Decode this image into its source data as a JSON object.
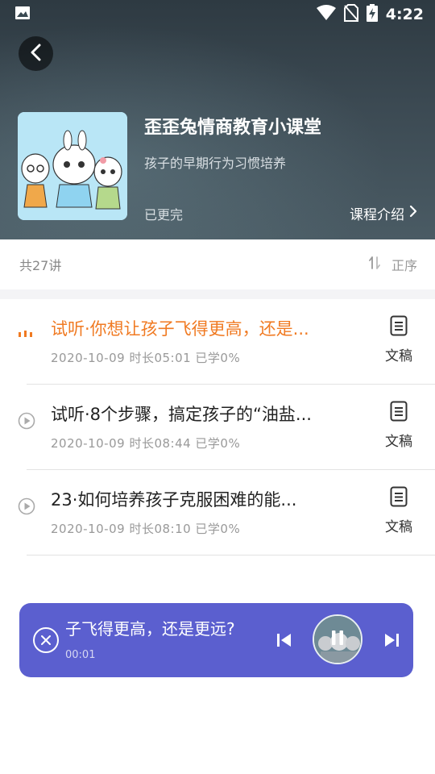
{
  "status_bar": {
    "time": "4:22",
    "icons": [
      "image-icon",
      "wifi-icon",
      "no-sim-icon",
      "battery-charging-icon"
    ]
  },
  "course": {
    "title": "歪歪兔情商教育小课堂",
    "subtitle": "孩子的早期行为习惯培养",
    "update_status": "已更完",
    "intro_link": "课程介绍"
  },
  "list_header": {
    "count": "共27讲",
    "sort_label": "正序"
  },
  "lessons": [
    {
      "title": "试听·你想让孩子飞得更高，还是...",
      "meta": "2020-10-09 时长05:01 已学0%",
      "doc_label": "文稿",
      "state": "playing"
    },
    {
      "title": "试听·8个步骤，搞定孩子的“油盐...",
      "meta": "2020-10-09 时长08:44 已学0%",
      "doc_label": "文稿",
      "state": "idle"
    },
    {
      "title": "23·如何培养孩子克服困难的能...",
      "meta": "2020-10-09 时长08:10 已学0%",
      "doc_label": "文稿",
      "state": "idle"
    }
  ],
  "player": {
    "title": "子飞得更高，还是更远?",
    "elapsed": "00:01"
  },
  "colors": {
    "accent_orange": "#f07a22",
    "player_bg": "#5b5fcf",
    "header_bg": "#3c4a53"
  }
}
